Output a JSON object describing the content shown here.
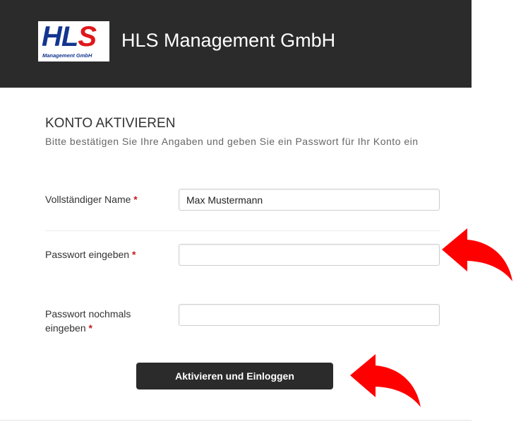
{
  "header": {
    "logo_main_a": "HL",
    "logo_main_b": "S",
    "logo_sub": "Management GmbH",
    "company_name": "HLS Management GmbH",
    "background_color": "#2b2b2b"
  },
  "form": {
    "title": "KONTO AKTIVIEREN",
    "description": "Bitte bestätigen Sie Ihre Angaben und geben Sie ein Passwort für Ihr Konto ein",
    "required_marker": "*",
    "fields": [
      {
        "label": "Vollständiger Name",
        "value": "Max Mustermann",
        "placeholder": ""
      },
      {
        "label": "Passwort eingeben",
        "value": "",
        "placeholder": ""
      },
      {
        "label_line1": "Passwort nochmals",
        "label_line2": "eingeben",
        "value": "",
        "placeholder": ""
      }
    ],
    "submit_label": "Aktivieren und Einloggen"
  },
  "annotations": {
    "arrow_icon": "curved-arrow-icon",
    "arrow_color": "#ff0000"
  }
}
